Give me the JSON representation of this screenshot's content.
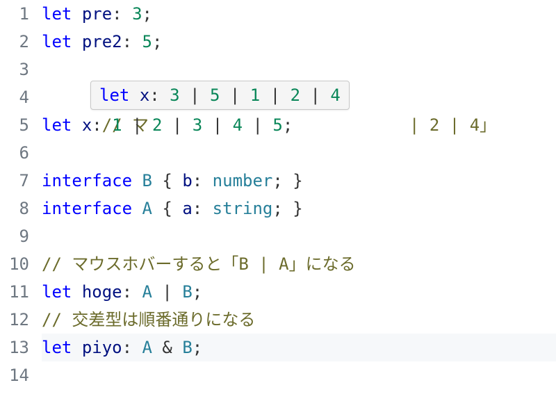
{
  "gutter": [
    "1",
    "2",
    "3",
    "4",
    "5",
    "6",
    "7",
    "8",
    "9",
    "10",
    "11",
    "12",
    "13",
    "14"
  ],
  "code": {
    "l1": {
      "kw": "let",
      "id": "pre",
      "colon": ":",
      "n": "3",
      "semi": ";"
    },
    "l2": {
      "kw": "let",
      "id": "pre2",
      "colon": ":",
      "n": "5",
      "semi": ";"
    },
    "l4": {
      "cmt_prefix": "// マ",
      "cmt_tail": " | 2 | 4」"
    },
    "l5": {
      "kw": "let",
      "id": "x",
      "colon": ":",
      "n1": "1",
      "n2": "2",
      "n3": "3",
      "n4": "4",
      "n5": "5",
      "semi": ";"
    },
    "l7": {
      "kw": "interface",
      "name": "B",
      "lb": "{",
      "field": "b",
      "colon": ":",
      "type": "number",
      "semi": ";",
      "rb": "}"
    },
    "l8": {
      "kw": "interface",
      "name": "A",
      "lb": "{",
      "field": "a",
      "colon": ":",
      "type": "string",
      "semi": ";",
      "rb": "}"
    },
    "l10": {
      "cmt": "// マウスホバーすると「B | A」になる"
    },
    "l11": {
      "kw": "let",
      "id": "hoge",
      "colon": ":",
      "t1": "A",
      "t2": "B",
      "semi": ";"
    },
    "l12": {
      "cmt": "// 交差型は順番通りになる"
    },
    "l13": {
      "kw": "let",
      "id": "piyo",
      "colon": ":",
      "t1": "A",
      "t2": "B",
      "semi": ";"
    }
  },
  "tooltip": {
    "kw": "let",
    "id": "x",
    "colon": ":",
    "n1": "3",
    "n2": "5",
    "n3": "1",
    "n4": "2",
    "n5": "4"
  }
}
